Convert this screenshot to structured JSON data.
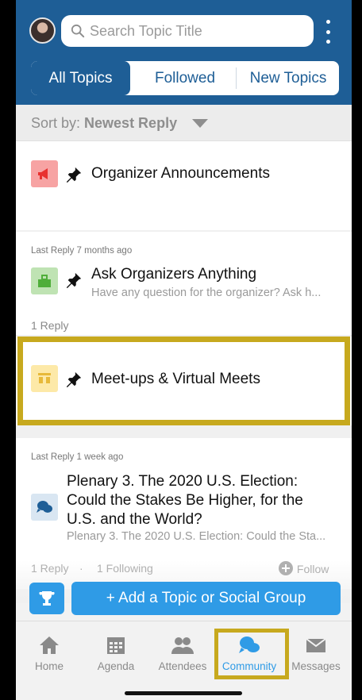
{
  "header": {
    "search_placeholder": "Search Topic Title",
    "tabs": [
      {
        "label": "All Topics",
        "active": true
      },
      {
        "label": "Followed",
        "active": false
      },
      {
        "label": "New Topics",
        "active": false
      }
    ]
  },
  "sort": {
    "label": "Sort by: ",
    "value": "Newest Reply"
  },
  "topics": [
    {
      "title": "Organizer Announcements",
      "icon": "megaphone-icon",
      "icon_bg": "#f7a3a3",
      "pinned": true
    },
    {
      "last_reply": "Last Reply 7 months ago",
      "title": "Ask Organizers Anything",
      "subtitle": "Have any question for the organizer? Ask h...",
      "icon": "ask-icon",
      "icon_bg": "#bfe3b3",
      "pinned": true,
      "replies": "1 Reply"
    },
    {
      "title": "Meet-ups & Virtual Meets",
      "icon": "meetup-icon",
      "icon_bg": "#fde9a8",
      "pinned": true
    },
    {
      "last_reply": "Last Reply 1 week ago",
      "title_lines": [
        "Plenary 3. The 2020 U.S. Election:",
        "Could the Stakes Be Higher, for the",
        "U.S. and the World?"
      ],
      "subtitle": "Plenary 3. The 2020 U.S. Election: Could the Sta...",
      "icon": "chat-bubbles-icon",
      "icon_bg": "#d9e6f2",
      "replies": "1 Reply",
      "following": "1 Following",
      "follow_label": "Follow"
    }
  ],
  "actions": {
    "add_topic_label": "+ Add a Topic or Social Group"
  },
  "tabbar": [
    {
      "label": "Home",
      "icon": "home-icon"
    },
    {
      "label": "Agenda",
      "icon": "calendar-icon"
    },
    {
      "label": "Attendees",
      "icon": "people-icon"
    },
    {
      "label": "Community",
      "icon": "chat-bubbles-icon",
      "active": true
    },
    {
      "label": "Messages",
      "icon": "envelope-icon"
    }
  ],
  "colors": {
    "header_blue": "#1e5e96",
    "accent_blue": "#2f9be6",
    "highlight_gold": "#c7a91e"
  }
}
